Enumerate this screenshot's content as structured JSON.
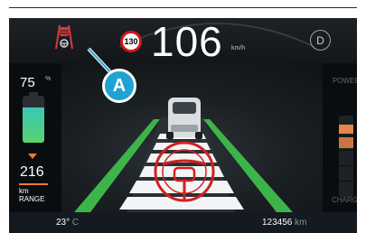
{
  "header": {
    "speed_limit": "130",
    "speed": "106",
    "speed_unit": "km/h",
    "gear": "D",
    "adas_icon": "lane-assist-car-icon"
  },
  "battery": {
    "percent": "75",
    "percent_symbol": "%",
    "level": 0.75,
    "range_value": "216",
    "range_unit": "km",
    "range_label": "RANGE",
    "indicator_color": "#f07c2a"
  },
  "gauge": {
    "power_label": "POWER",
    "charge_label": "CHARGE",
    "accent_color": "#e8834a"
  },
  "footer": {
    "temperature": "23°",
    "temperature_unit": "C",
    "odometer": "123456",
    "odometer_unit": "km"
  },
  "callout": {
    "label": "A",
    "color": "#1ea3d3"
  },
  "scene": {
    "lane_color": "#3db449",
    "steering_color": "#d32020",
    "car_icon": "car-ahead-icon",
    "steering_icon": "steering-wheel-icon"
  }
}
